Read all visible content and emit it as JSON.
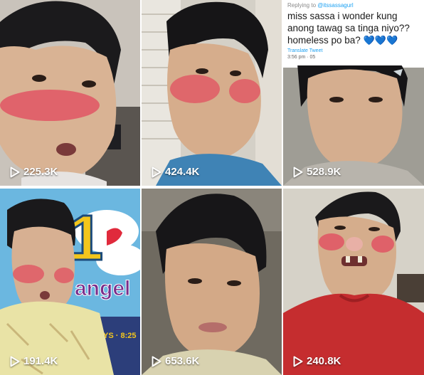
{
  "tiles": [
    {
      "views": "225.3K",
      "play_icon": "play-icon"
    },
    {
      "views": "424.4K",
      "play_icon": "play-icon"
    },
    {
      "views": "528.9K",
      "play_icon": "play-icon"
    },
    {
      "views": "191.4K",
      "play_icon": "play-icon"
    },
    {
      "views": "653.6K",
      "play_icon": "play-icon"
    },
    {
      "views": "240.8K",
      "play_icon": "play-icon"
    }
  ],
  "tweet": {
    "replying_prefix": "Replying to",
    "replying_handle": "@itssassagurl",
    "text": "miss sassa i wonder kung anong tawag sa tinga niyo?? homeless po ba?",
    "hearts": "💙💙💙",
    "translate": "Translate Tweet",
    "time": "3:56 pm · 05"
  },
  "poster": {
    "big_letter": "1",
    "word": "angel",
    "partial_text": "YS · 8:25"
  },
  "colors": {
    "blush": "#e2485d",
    "play_count_text": "#ffffff",
    "tweet_link": "#1da1f2",
    "shirt_red": "#c52d2f",
    "shirt_blue": "#3f83b5",
    "shirt_yellow": "#e9e3a6"
  }
}
